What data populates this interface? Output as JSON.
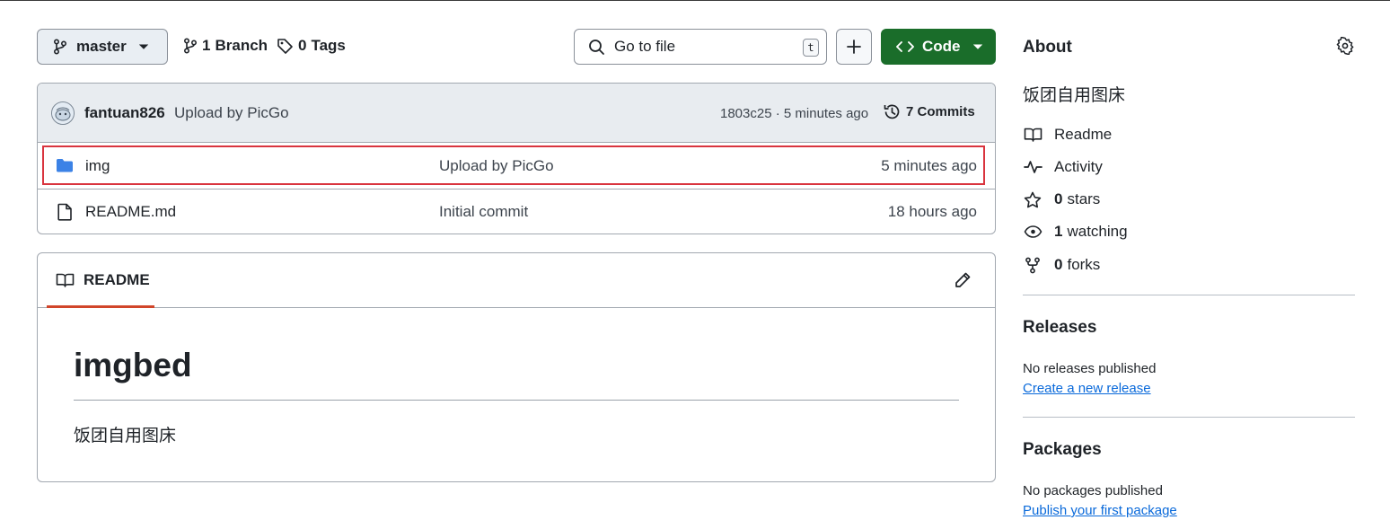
{
  "toolbar": {
    "branch": "master",
    "branches_count": "1",
    "branches_label": "Branch",
    "tags_count": "0",
    "tags_label": "Tags",
    "search_placeholder": "Go to file",
    "search_shortcut": "t",
    "code_label": "Code",
    "accent_color": "#1a6d2a"
  },
  "latest_commit": {
    "author": "fantuan826",
    "message": "Upload by PicGo",
    "hash_time": "1803c25 · 5 minutes ago",
    "commits_label": "7 Commits"
  },
  "files": [
    {
      "icon": "folder-icon",
      "name": "img",
      "message": "Upload by PicGo",
      "time": "5 minutes ago",
      "highlighted": true
    },
    {
      "icon": "file-icon",
      "name": "README.md",
      "message": "Initial commit",
      "time": "18 hours ago",
      "highlighted": false
    }
  ],
  "readme": {
    "tab_label": "README",
    "heading": "imgbed",
    "body": "饭团自用图床"
  },
  "about": {
    "title": "About",
    "description": "饭团自用图床",
    "readme_label": "Readme",
    "activity_label": "Activity",
    "stars_count": "0",
    "stars_label": "stars",
    "watching_count": "1",
    "watching_label": "watching",
    "forks_count": "0",
    "forks_label": "forks"
  },
  "releases": {
    "title": "Releases",
    "text": "No releases published",
    "link": "Create a new release"
  },
  "packages": {
    "title": "Packages",
    "text": "No packages published",
    "link": "Publish your first package"
  }
}
